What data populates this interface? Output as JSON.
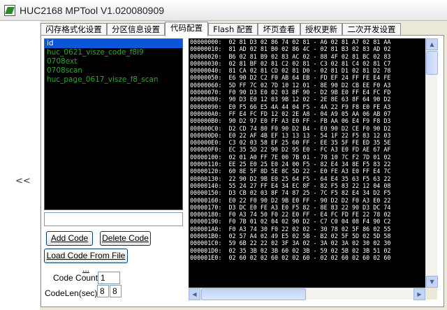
{
  "window": {
    "title": "HUC2168 MPTool V1.020080909"
  },
  "left_strip": {
    "collapse_label": "<<"
  },
  "tabs": [
    {
      "label": "闪存格式化设置"
    },
    {
      "label": "分区信息设置"
    },
    {
      "label": "代码配置"
    },
    {
      "label": "Flash 配置"
    },
    {
      "label": "坏页查看"
    },
    {
      "label": "授权更新"
    },
    {
      "label": "二次开发设置"
    }
  ],
  "active_tab": 2,
  "code_list": {
    "items": [
      "id",
      "huc_0621_visze_code_f8l9",
      "0708ext",
      "0708scan",
      "huc_page_0617_visze_f8_scan"
    ],
    "selected_index": 0
  },
  "code_name_input": {
    "value": ""
  },
  "buttons": {
    "add_code": "Add Code",
    "delete_code": "Delete Code",
    "load_code": "Load Code From File ..."
  },
  "fields": {
    "code_count_label": "Code Count",
    "code_count_value": "1",
    "code_len_label": "CodeLen(sec)",
    "code_len_value_1": "8",
    "code_len_value_2": "8"
  },
  "hex_dump": {
    "rows": [
      "00000000:  02 81 D3 02 86 74 02 81 - A6 02 81 A7 02 81 AA",
      "00000010:  81 AD 02 81 B0 02 86 4C - 02 81 B3 02 83 AD 02",
      "00000020:  B6 02 81 B9 02 83 AC 02 - 88 4F 02 81 BC 02 83",
      "00000030:  02 81 BF 02 81 C2 02 81 - C3 02 81 C4 02 81 C7",
      "00000040:  81 CA 02 81 CD 02 81 D0 - 02 81 D1 02 81 D2 78",
      "00000050:  E6 90 D2 C2 F0 AB 64 EB - FD EF 24 FF FE E4 FE",
      "00000060:  5D FF 7C 02 7D 10 12 01 - 8E 90 D2 CB EE F0 A3",
      "00000070:  F0 90 D3 E0 02 03 8F 90 - D2 9B E0 FF E4 FC FD",
      "00000080:  90 D3 E0 12 03 9B 12 02 - 2E 8E 63 8F 64 90 D2",
      "00000090:  E0 F5 66 E5 4A 44 04 F5 - 4A 22 F9 F8 E0 FE A3",
      "000000A0:  FF E4 FC FD 12 02 2E A8 - 04 A9 05 AA 06 AB 07",
      "000000B0:  90 D2 97 E0 FF A3 E0 FF - FB AA 06 E4 F9 F8 D3",
      "000000C0:  D2 CD 74 80 F0 90 D2 B4 - E0 90 D2 CE F0 90 D2",
      "000000D0:  E0 22 AF 4B EF 13 13 13 - 54 1F 22 F5 83 12 03",
      "000000E0:  C3 02 03 58 EF 25 60 FF - EE 35 5F FE ED 35 5E",
      "000000F0:  EC 35 5D 22 90 D2 95 E0 - FC A3 E0 FD AE 67 AF",
      "00000100:  02 01 A0 FF 7E 00 7B 01 - 78 10 7C F2 7D 01 02",
      "00000110:  EE 25 E0 25 E0 24 00 F5 - 82 E4 34 8E F5 83 22",
      "00000120:  60 8E 5F 8D 5E 8C 5D 22 - E0 FE A3 E0 FF E4 7C",
      "00000130:  22 90 D2 9B E0 25 64 F5 - 64 E4 35 63 F5 63 22",
      "00000140:  55 24 27 FF E4 34 EC 8F - 82 F5 83 22 12 04 08",
      "00000150:  D3 CB 02 03 8F 74 87 25 - 7C F5 82 E4 34 D2 F5",
      "00000160:  E0 22 F0 90 D2 9B E0 FF - 90 D2 D2 F0 A3 E0 22",
      "00000170:  D3 DC E0 FE A3 E0 F5 82 - 8E 83 22 90 D3 DC 74",
      "00000180:  F0 A3 74 50 F0 22 E0 FF - E4 FC FD FE 22 78 02",
      "00000190:  F0 7B 01 02 04 02 90 D2 - C7 C0 04 08 F4 90 C2",
      "000001A0:  F0 A3 74 30 F0 22 02 02 - 30 78 02 5F 86 02 55",
      "000001B0:  02 57 A4 02 49 E5 02 5B - B2 02 5F 5D 02 5D 58",
      "000001C0:  59 6B 22 22 02 3F 3A 02 - 3A 02 3A 02 30 02 30",
      "000001D0:  02 35 3B 02 3B 60 02 3B - 59 02 5B 02 3B 51 02",
      "000001E0:  02 60 02 02 60 02 02 60 - 02 02 60 02 60 02 60"
    ]
  },
  "colors": {
    "list_text": "#2fa52f",
    "selection": "#0a56d4",
    "hex_background": "#000000",
    "hex_text": "#ffffff"
  }
}
